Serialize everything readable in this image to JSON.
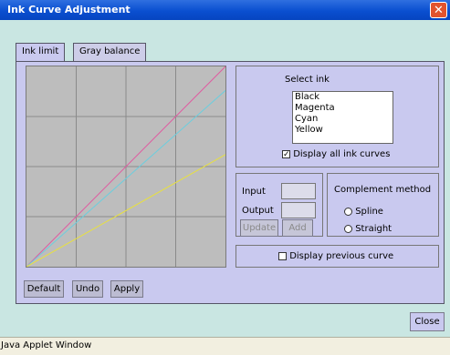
{
  "window": {
    "title": "Ink Curve Adjustment",
    "close_glyph": "✕"
  },
  "tabs": [
    {
      "label": "Ink limit"
    },
    {
      "label": "Gray balance"
    }
  ],
  "select_ink": {
    "label": "Select ink",
    "items": [
      "Black",
      "Magenta",
      "Cyan",
      "Yellow"
    ],
    "display_all_label": "Display all ink curves",
    "display_all_checked": true
  },
  "io": {
    "input_label": "Input",
    "output_label": "Output",
    "input_value": "",
    "output_value": "",
    "update_label": "Update",
    "add_label": "Add"
  },
  "complement": {
    "label": "Complement method",
    "spline_label": "Spline",
    "straight_label": "Straight"
  },
  "display_previous": {
    "label": "Display previous curve",
    "checked": false
  },
  "buttons": {
    "default": "Default",
    "undo": "Undo",
    "apply": "Apply",
    "close": "Close"
  },
  "status_bar": "Java Applet Window",
  "curves": [
    {
      "name": "magenta",
      "color": "#e05aa0",
      "end_level": 1.0
    },
    {
      "name": "cyan",
      "color": "#6ccede",
      "end_level": 0.88
    },
    {
      "name": "yellow",
      "color": "#e8e040",
      "end_level": 0.56
    }
  ],
  "colors": {
    "titlebar": "#0a4fd0",
    "client_bg": "#c9e6e2",
    "panel_bg": "#c9c9ef"
  }
}
